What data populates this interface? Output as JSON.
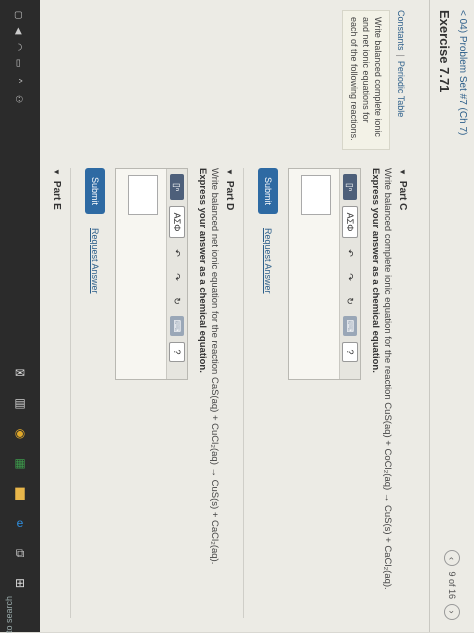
{
  "taskbar": {
    "search_text": "to search",
    "apps": [
      {
        "icon": "task-view-icon",
        "glyph": "⧉",
        "color": "#c9c9c9"
      },
      {
        "icon": "edge-icon",
        "glyph": "e",
        "color": "#2f8fe0"
      },
      {
        "icon": "folder-icon",
        "glyph": "▇",
        "color": "#e8b64a"
      },
      {
        "icon": "store-icon",
        "glyph": "▦",
        "color": "#3c9a4b"
      },
      {
        "icon": "chrome-icon",
        "glyph": "◉",
        "color": "#e0a82a"
      },
      {
        "icon": "calculator-icon",
        "glyph": "▤",
        "color": "#d0d0d0"
      },
      {
        "icon": "mail-icon",
        "glyph": "✉",
        "color": "#e0e0e0"
      }
    ]
  },
  "header": {
    "back_link": "< 04) Problem Set #7 (Ch 7)",
    "exercise_title": "Exercise 7.71",
    "pager_text": "9 of 16"
  },
  "left": {
    "link_constants": "Constants",
    "link_separator": "|",
    "link_periodic": "Periodic Table",
    "instructions": "Write balanced complete ionic and net ionic equations for each of the following reactions."
  },
  "part_c": {
    "title": "Part C",
    "question": "Write balanced complete ionic equation for the reaction CuS(aq) + CoCl₂(aq) → CuS(s) + CaCl₂(aq).",
    "instruction": "Express your answer as a chemical equation.",
    "submit": "Submit",
    "request": "Request Answer"
  },
  "part_d": {
    "title": "Part D",
    "question": "Write balanced net ionic equation for the reaction CaS(aq) + CuCl₂(aq) → CuS(s) + CaCl₂(aq).",
    "instruction": "Express your answer as a chemical equation.",
    "submit": "Submit",
    "request": "Request Answer"
  },
  "part_e": {
    "title": "Part E"
  },
  "editor": {
    "template_label": "▯ⁿ",
    "greek_label": "ΑΣΦ",
    "undo": "↶",
    "redo": "↷",
    "reset": "↻",
    "keyboard": "⌨",
    "help": "?"
  },
  "colors": {
    "accent": "#2e6aa3",
    "link": "#2d5f8a",
    "taskbar": "#2b2b2b"
  }
}
